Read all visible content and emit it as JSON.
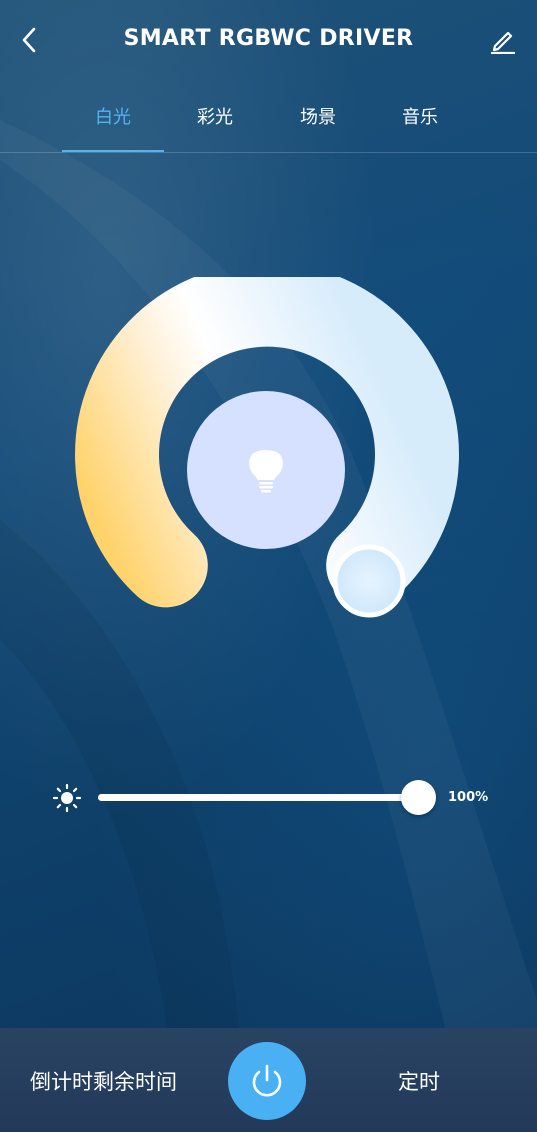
{
  "header": {
    "title": "SMART RGBWC DRIVER",
    "back_icon": "chevron-left-icon",
    "edit_icon": "pencil-icon"
  },
  "tabs": [
    {
      "label": "白光",
      "active": true
    },
    {
      "label": "彩光",
      "active": false
    },
    {
      "label": "场景",
      "active": false
    },
    {
      "label": "音乐",
      "active": false
    }
  ],
  "color_temperature": {
    "warm_color": "#ffd26a",
    "cool_color": "#dcefff",
    "center_color": "#d6e0ff",
    "center_icon": "lightbulb-icon",
    "handle_position": "cool-end"
  },
  "brightness": {
    "icon": "sun-icon",
    "value": 1.0,
    "label": "100%"
  },
  "bottom_bar": {
    "countdown_label": "倒计时剩余时间",
    "power_icon": "power-icon",
    "power_color": "#49b1f3",
    "timer_label": "定时"
  },
  "colors": {
    "accent": "#53b4f5",
    "background": "#124a78"
  }
}
